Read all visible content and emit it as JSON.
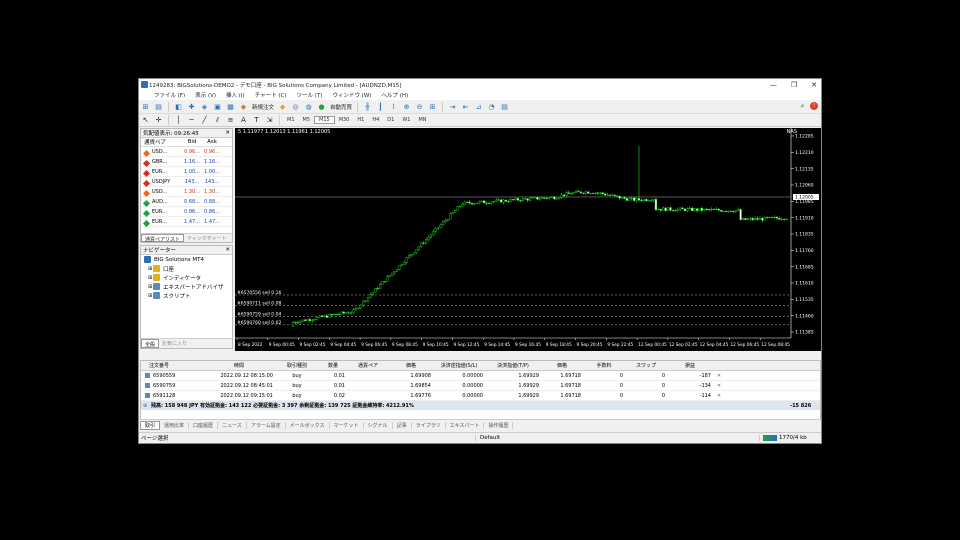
{
  "window": {
    "title": "1249283: BIGSolutions-DEMO2 - デモ口座 - BIG Solutions Company Limited - [AUDNZD,M15]",
    "minimize": "—",
    "maximize": "❐",
    "close": "✕"
  },
  "menu": [
    "ファイル (F)",
    "表示 (V)",
    "挿入 (I)",
    "チャート (C)",
    "ツール (T)",
    "ウィンドウ (W)",
    "ヘルプ (H)"
  ],
  "toolbar": {
    "new_order": "新規注文",
    "auto_trade": "自動売買",
    "timeframes": [
      "M1",
      "M5",
      "M15",
      "M30",
      "H1",
      "H4",
      "D1",
      "W1",
      "MN"
    ]
  },
  "market_watch": {
    "title": "気配値表示: 09:26:45",
    "col_symbol": "通貨ペア",
    "col_bid": "Bid",
    "col_ask": "Ask",
    "rows": [
      {
        "symbol": "USD...",
        "bid": "0.96...",
        "ask": "0.96...",
        "color": "#e07020",
        "price_color": "#d03020"
      },
      {
        "symbol": "GBR...",
        "bid": "1.16...",
        "ask": "1.16...",
        "color": "#d03020",
        "price_color": "#1e40c0"
      },
      {
        "symbol": "EUR...",
        "bid": "1.00...",
        "ask": "1.00...",
        "color": "#d03020",
        "price_color": "#1e40c0"
      },
      {
        "symbol": "USDJPY",
        "bid": "143...",
        "ask": "143...",
        "color": "#d03020",
        "price_color": "#1e40c0"
      },
      {
        "symbol": "USD...",
        "bid": "1.30...",
        "ask": "1.30...",
        "color": "#e07020",
        "price_color": "#d03020"
      },
      {
        "symbol": "AUD...",
        "bid": "0.68...",
        "ask": "0.68...",
        "color": "#20a040",
        "price_color": "#1e40c0"
      },
      {
        "symbol": "EUR...",
        "bid": "0.86...",
        "ask": "0.86...",
        "color": "#20a040",
        "price_color": "#1e40c0"
      },
      {
        "symbol": "EUR...",
        "bid": "1.47...",
        "ask": "1.47...",
        "color": "#20a040",
        "price_color": "#1e40c0"
      }
    ],
    "tab_symbols": "通貨ペアリスト",
    "tab_tick": "ティックチャート"
  },
  "navigator": {
    "title": "ナビゲーター",
    "root": "BIG Solutions MT4",
    "items": [
      "口座",
      "インディケータ",
      "エキスパートアドバイザ",
      "スクリプト"
    ],
    "tab_common": "全般",
    "tab_favorites": "お気に入り"
  },
  "chart": {
    "header": "5 1.11977 1.12013 1.11961 1.12005",
    "symbol_badge": "NAS",
    "current_price": "1.12005",
    "order_lines": [
      {
        "label": "#6570556 sell 0.16",
        "price": 1.11555
      },
      {
        "label": "#6590711 sell 0.08",
        "price": 1.11507
      },
      {
        "label": "#6590759 sell 0.04",
        "price": 1.11456
      },
      {
        "label": "#6590760 sell 0.02",
        "price": 1.11418
      }
    ],
    "y_ticks": [
      "1.12285",
      "1.12210",
      "1.12135",
      "1.12060",
      "1.11985",
      "1.11910",
      "1.11835",
      "1.11760",
      "1.11685",
      "1.11610",
      "1.11535",
      "1.11460",
      "1.11385"
    ],
    "x_ticks": [
      "8 Sep 2022",
      "9 Sep 00:45",
      "9 Sep 02:45",
      "9 Sep 04:45",
      "9 Sep 06:45",
      "9 Sep 08:45",
      "9 Sep 10:45",
      "9 Sep 12:45",
      "9 Sep 14:45",
      "9 Sep 16:45",
      "9 Sep 18:45",
      "9 Sep 20:45",
      "9 Sep 22:45",
      "12 Sep 00:45",
      "12 Sep 02:45",
      "12 Sep 04:45",
      "12 Sep 06:45",
      "12 Sep 08:45"
    ]
  },
  "terminal": {
    "headers": [
      "注文番号",
      "時間",
      "取引種別",
      "数量",
      "通貨ペア",
      "価格",
      "決済逆指値(S/L)",
      "決済指値(T/P)",
      "価格",
      "手数料",
      "スワップ",
      "損益"
    ],
    "rows": [
      {
        "id": "6590559",
        "time": "2022.09.12 08:15:00",
        "type": "buy",
        "size": "0.01",
        "symbol": "",
        "price": "1.69908",
        "sl": "0.00000",
        "tp": "1.69929",
        "cur": "1.69718",
        "comm": "0",
        "swap": "0",
        "profit": "-187"
      },
      {
        "id": "6590759",
        "time": "2022.09.12 08:45:01",
        "type": "buy",
        "size": "0.01",
        "symbol": "",
        "price": "1.69854",
        "sl": "0.00000",
        "tp": "1.69929",
        "cur": "1.69718",
        "comm": "0",
        "swap": "0",
        "profit": "-134"
      },
      {
        "id": "6591128",
        "time": "2022.09.12 09:15:01",
        "type": "buy",
        "size": "0.02",
        "symbol": "",
        "price": "1.69776",
        "sl": "0.00000",
        "tp": "1.69929",
        "cur": "1.69718",
        "comm": "0",
        "swap": "0",
        "profit": "-114"
      }
    ],
    "balance_line": "残高: 158 948 JPY  有効証拠金: 143 122  必要証拠金: 3 397  余剰証拠金: 139 725  証拠金維持率: 4212.91%",
    "total": "-15 826",
    "tabs": [
      "取引",
      "運用比率",
      "口座履歴",
      "ニュース",
      "アラーム設定",
      "メールボックス",
      "マーケット",
      "シグナル",
      "記事",
      "ライブラリ",
      "エキスパート",
      "操作履歴"
    ]
  },
  "status": {
    "left": "ページ選択",
    "profile": "Default",
    "traffic": "1770/4 kb"
  }
}
